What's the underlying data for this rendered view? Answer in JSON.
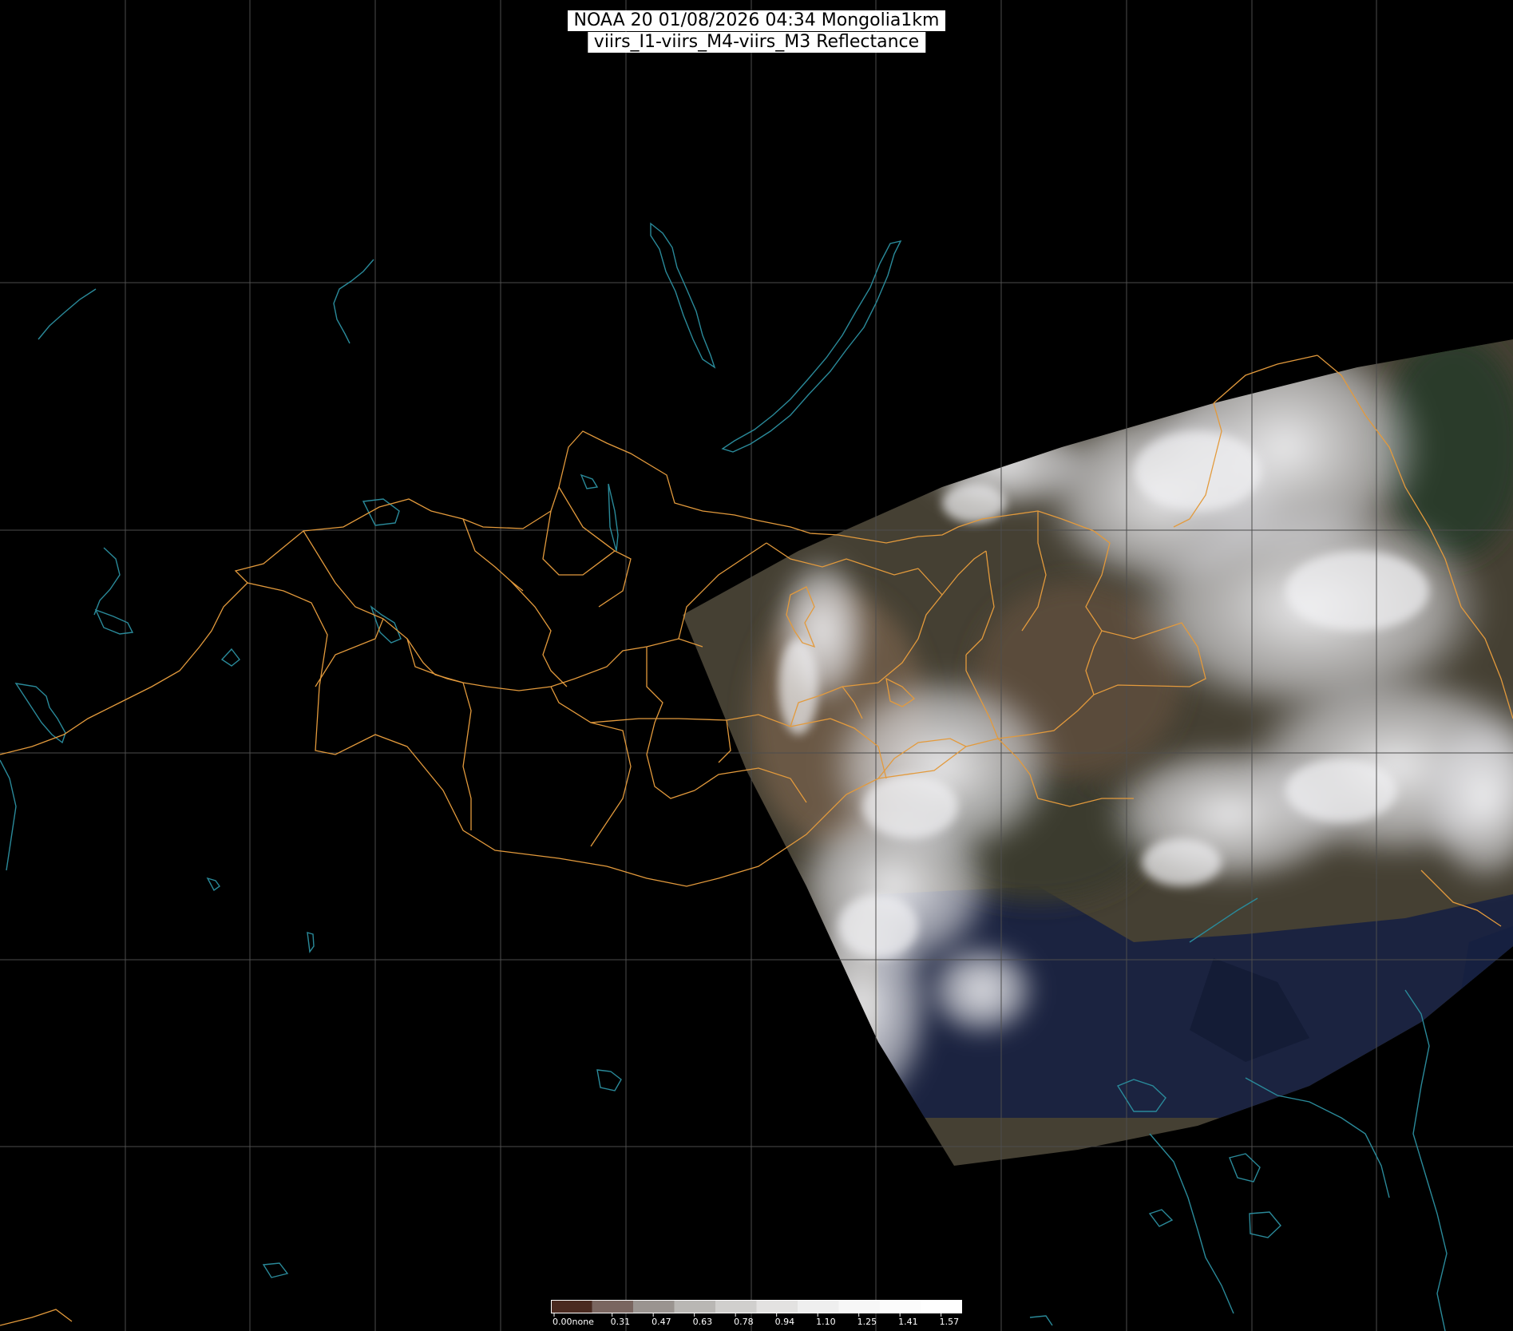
{
  "title": {
    "line1": "NOAA 20 01/08/2026 04:34 Mongolia1km",
    "line2": "viirs_I1-viirs_M4-viirs_M3 Reflectance"
  },
  "colorbar": {
    "labels": [
      "0.00none",
      "0.31",
      "0.47",
      "0.63",
      "0.78",
      "0.94",
      "1.10",
      "1.25",
      "1.41",
      "1.57"
    ],
    "colors": [
      "#4a2a20",
      "#7a6660",
      "#9a9490",
      "#b9b7b4",
      "#d0cfcd",
      "#e3e2e1",
      "#efefef",
      "#f7f7f7",
      "#fcfcfc",
      "#ffffff"
    ]
  },
  "colors": {
    "background": "#000000",
    "grid": "#555555",
    "borders": "#e39a3c",
    "water": "#2a8a9a",
    "cloud": "#e8e8ea",
    "land": "#4a4232",
    "sea": "#1a2240"
  }
}
